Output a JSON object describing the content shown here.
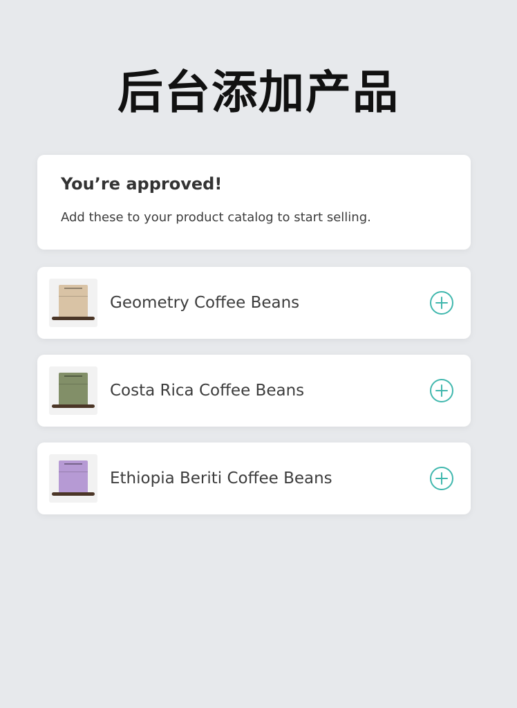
{
  "header": {
    "title": "后台添加产品"
  },
  "approval": {
    "heading": "You’re approved!",
    "message": "Add these to your product catalog to start selling."
  },
  "products": [
    {
      "name": "Geometry Coffee Beans",
      "bag_color": "#d9c3a5",
      "action_icon": "plus-circle-icon"
    },
    {
      "name": "Costa Rica Coffee Beans",
      "bag_color": "#828f68",
      "action_icon": "plus-circle-icon"
    },
    {
      "name": "Ethiopia Beriti Coffee Beans",
      "bag_color": "#b69ad4",
      "action_icon": "plus-circle-icon"
    }
  ],
  "colors": {
    "accent": "#3fb7ad",
    "background": "#e7e9ec",
    "card": "#ffffff",
    "text": "#3c3c3c"
  }
}
